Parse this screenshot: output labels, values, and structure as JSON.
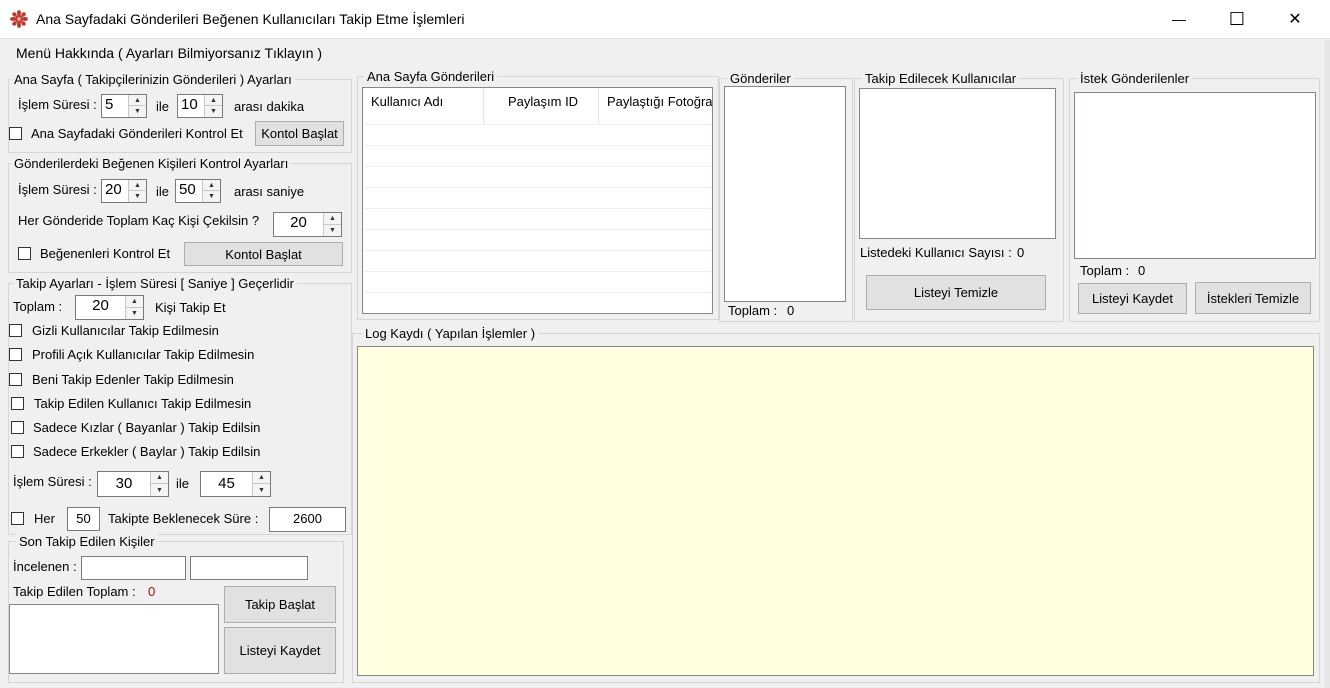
{
  "window": {
    "title": "Ana Sayfadaki Gönderileri Beğenen Kullanıcıları Takip Etme İşlemleri",
    "minimize_glyph": "—",
    "maximize_glyph": "☐",
    "close_glyph": "✕"
  },
  "menu": {
    "about_label": "Menü Hakkında ( Ayarları Bilmiyorsanız Tıklayın )"
  },
  "home_settings": {
    "title": "Ana Sayfa ( Takipçilerinizin Gönderileri ) Ayarları",
    "duration_label": "İşlem Süresi :",
    "from_value": "5",
    "and_label": "ile",
    "to_value": "10",
    "unit_label": "arası dakika",
    "check_label": "Ana Sayfadaki Gönderileri Kontrol Et",
    "check_checked": false,
    "start_button": "Kontol Başlat"
  },
  "likers_settings": {
    "title": "Gönderilerdeki Beğenen Kişileri Kontrol Ayarları",
    "duration_label": "İşlem Süresi :",
    "from_value": "20",
    "and_label": "ile",
    "to_value": "50",
    "unit_label": "arası saniye",
    "per_post_label": "Her Gönderide Toplam Kaç Kişi Çekilsin ?",
    "per_post_value": "20",
    "check_label": "Beğenenleri Kontrol Et",
    "check_checked": false,
    "start_button": "Kontol Başlat"
  },
  "follow_settings": {
    "title": "Takip Ayarları - İşlem Süresi [ Saniye ] Geçerlidir",
    "total_label": "Toplam :",
    "total_value": "20",
    "follow_unit_label": "Kişi Takip Et",
    "options": [
      {
        "label": "Gizli Kullanıcılar Takip Edilmesin",
        "checked": false
      },
      {
        "label": "Profili Açık Kullanıcılar Takip Edilmesin",
        "checked": false
      },
      {
        "label": "Beni Takip Edenler Takip Edilmesin",
        "checked": false
      },
      {
        "label": "Takip Edilen Kullanıcı Takip Edilmesin",
        "checked": false
      },
      {
        "label": "Sadece Kızlar ( Bayanlar ) Takip Edilsin",
        "checked": false
      },
      {
        "label": "Sadece Erkekler ( Baylar ) Takip Edilsin",
        "checked": false
      }
    ],
    "duration_label": "İşlem Süresi :",
    "from_value": "30",
    "and_label": "ile",
    "to_value": "45",
    "every_label": "Her",
    "every_value": "50",
    "wait_label": "Takipte Beklenecek Süre :",
    "wait_value": "2600",
    "every_checked": false
  },
  "last_followed": {
    "title": "Son Takip Edilen Kişiler",
    "inspected_label": "İncelenen :",
    "inspected_value_1": "",
    "inspected_value_2": "",
    "total_label": "Takip Edilen Toplam :",
    "total_value": "0",
    "start_button": "Takip Başlat",
    "save_button": "Listeyi Kaydet"
  },
  "home_posts": {
    "title": "Ana Sayfa Gönderileri",
    "columns": [
      "Kullanıcı Adı",
      "Paylaşım ID",
      "Paylaştığı Fotoğraf"
    ]
  },
  "posts": {
    "title": "Gönderiler",
    "total_label": "Toplam :",
    "total_value": "0"
  },
  "to_follow": {
    "title": "Takip Edilecek Kullanıcılar",
    "count_label": "Listedeki Kullanıcı Sayısı :",
    "count_value": "0",
    "clear_button": "Listeyi Temizle"
  },
  "requests": {
    "title": "İstek Gönderilenler",
    "total_label": "Toplam :",
    "total_value": "0",
    "save_button": "Listeyi Kaydet",
    "clear_button": "İstekleri Temizle"
  },
  "log": {
    "title": "Log Kaydı ( Yapılan İşlemler )"
  },
  "colors": {
    "log_background": "#ffffe0",
    "total_count": "#c00000",
    "app_icon": "#c0392b"
  }
}
